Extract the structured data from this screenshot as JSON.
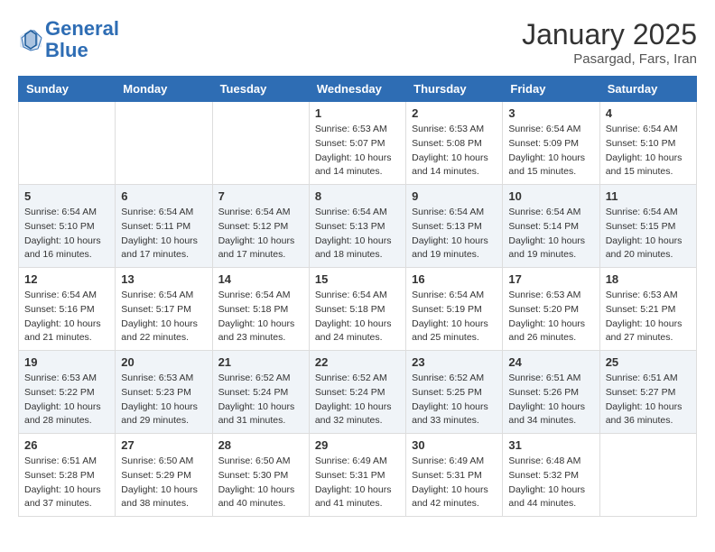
{
  "header": {
    "logo_line1": "General",
    "logo_line2": "Blue",
    "month_title": "January 2025",
    "subtitle": "Pasargad, Fars, Iran"
  },
  "weekdays": [
    "Sunday",
    "Monday",
    "Tuesday",
    "Wednesday",
    "Thursday",
    "Friday",
    "Saturday"
  ],
  "weeks": [
    [
      {
        "day": "",
        "info": ""
      },
      {
        "day": "",
        "info": ""
      },
      {
        "day": "",
        "info": ""
      },
      {
        "day": "1",
        "info": "Sunrise: 6:53 AM\nSunset: 5:07 PM\nDaylight: 10 hours\nand 14 minutes."
      },
      {
        "day": "2",
        "info": "Sunrise: 6:53 AM\nSunset: 5:08 PM\nDaylight: 10 hours\nand 14 minutes."
      },
      {
        "day": "3",
        "info": "Sunrise: 6:54 AM\nSunset: 5:09 PM\nDaylight: 10 hours\nand 15 minutes."
      },
      {
        "day": "4",
        "info": "Sunrise: 6:54 AM\nSunset: 5:10 PM\nDaylight: 10 hours\nand 15 minutes."
      }
    ],
    [
      {
        "day": "5",
        "info": "Sunrise: 6:54 AM\nSunset: 5:10 PM\nDaylight: 10 hours\nand 16 minutes."
      },
      {
        "day": "6",
        "info": "Sunrise: 6:54 AM\nSunset: 5:11 PM\nDaylight: 10 hours\nand 17 minutes."
      },
      {
        "day": "7",
        "info": "Sunrise: 6:54 AM\nSunset: 5:12 PM\nDaylight: 10 hours\nand 17 minutes."
      },
      {
        "day": "8",
        "info": "Sunrise: 6:54 AM\nSunset: 5:13 PM\nDaylight: 10 hours\nand 18 minutes."
      },
      {
        "day": "9",
        "info": "Sunrise: 6:54 AM\nSunset: 5:13 PM\nDaylight: 10 hours\nand 19 minutes."
      },
      {
        "day": "10",
        "info": "Sunrise: 6:54 AM\nSunset: 5:14 PM\nDaylight: 10 hours\nand 19 minutes."
      },
      {
        "day": "11",
        "info": "Sunrise: 6:54 AM\nSunset: 5:15 PM\nDaylight: 10 hours\nand 20 minutes."
      }
    ],
    [
      {
        "day": "12",
        "info": "Sunrise: 6:54 AM\nSunset: 5:16 PM\nDaylight: 10 hours\nand 21 minutes."
      },
      {
        "day": "13",
        "info": "Sunrise: 6:54 AM\nSunset: 5:17 PM\nDaylight: 10 hours\nand 22 minutes."
      },
      {
        "day": "14",
        "info": "Sunrise: 6:54 AM\nSunset: 5:18 PM\nDaylight: 10 hours\nand 23 minutes."
      },
      {
        "day": "15",
        "info": "Sunrise: 6:54 AM\nSunset: 5:18 PM\nDaylight: 10 hours\nand 24 minutes."
      },
      {
        "day": "16",
        "info": "Sunrise: 6:54 AM\nSunset: 5:19 PM\nDaylight: 10 hours\nand 25 minutes."
      },
      {
        "day": "17",
        "info": "Sunrise: 6:53 AM\nSunset: 5:20 PM\nDaylight: 10 hours\nand 26 minutes."
      },
      {
        "day": "18",
        "info": "Sunrise: 6:53 AM\nSunset: 5:21 PM\nDaylight: 10 hours\nand 27 minutes."
      }
    ],
    [
      {
        "day": "19",
        "info": "Sunrise: 6:53 AM\nSunset: 5:22 PM\nDaylight: 10 hours\nand 28 minutes."
      },
      {
        "day": "20",
        "info": "Sunrise: 6:53 AM\nSunset: 5:23 PM\nDaylight: 10 hours\nand 29 minutes."
      },
      {
        "day": "21",
        "info": "Sunrise: 6:52 AM\nSunset: 5:24 PM\nDaylight: 10 hours\nand 31 minutes."
      },
      {
        "day": "22",
        "info": "Sunrise: 6:52 AM\nSunset: 5:24 PM\nDaylight: 10 hours\nand 32 minutes."
      },
      {
        "day": "23",
        "info": "Sunrise: 6:52 AM\nSunset: 5:25 PM\nDaylight: 10 hours\nand 33 minutes."
      },
      {
        "day": "24",
        "info": "Sunrise: 6:51 AM\nSunset: 5:26 PM\nDaylight: 10 hours\nand 34 minutes."
      },
      {
        "day": "25",
        "info": "Sunrise: 6:51 AM\nSunset: 5:27 PM\nDaylight: 10 hours\nand 36 minutes."
      }
    ],
    [
      {
        "day": "26",
        "info": "Sunrise: 6:51 AM\nSunset: 5:28 PM\nDaylight: 10 hours\nand 37 minutes."
      },
      {
        "day": "27",
        "info": "Sunrise: 6:50 AM\nSunset: 5:29 PM\nDaylight: 10 hours\nand 38 minutes."
      },
      {
        "day": "28",
        "info": "Sunrise: 6:50 AM\nSunset: 5:30 PM\nDaylight: 10 hours\nand 40 minutes."
      },
      {
        "day": "29",
        "info": "Sunrise: 6:49 AM\nSunset: 5:31 PM\nDaylight: 10 hours\nand 41 minutes."
      },
      {
        "day": "30",
        "info": "Sunrise: 6:49 AM\nSunset: 5:31 PM\nDaylight: 10 hours\nand 42 minutes."
      },
      {
        "day": "31",
        "info": "Sunrise: 6:48 AM\nSunset: 5:32 PM\nDaylight: 10 hours\nand 44 minutes."
      },
      {
        "day": "",
        "info": ""
      }
    ]
  ]
}
